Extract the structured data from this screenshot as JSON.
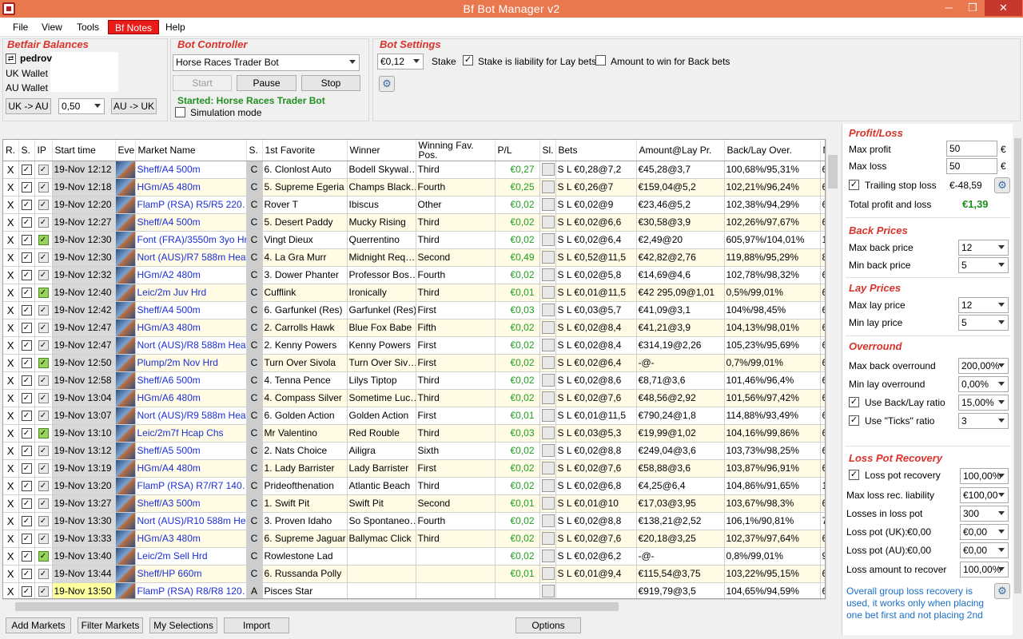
{
  "window": {
    "title": "Bf Bot Manager v2",
    "min": "─",
    "max": "❐",
    "close": "✕"
  },
  "menu": [
    "File",
    "View",
    "Tools",
    "Bf Notes",
    "Help"
  ],
  "balances": {
    "title": "Betfair Balances",
    "user": "pedrov",
    "uk_wallet": "UK Wallet",
    "au_wallet": "AU Wallet",
    "uk_to_au": "UK -> AU",
    "amount": "0,50",
    "au_to_uk": "AU -> UK"
  },
  "controller": {
    "title": "Bot Controller",
    "bot": "Horse Races Trader Bot",
    "start": "Start",
    "pause": "Pause",
    "stop": "Stop",
    "status": "Started: Horse Races Trader Bot",
    "simulation": "Simulation mode"
  },
  "settings": {
    "title": "Bot Settings",
    "stake_value": "€0,12",
    "stake": "Stake",
    "liability": "Stake is liability for Lay bets",
    "amount_win": "Amount to win for Back bets"
  },
  "grid": {
    "headers": [
      "R.",
      "S.",
      "IP",
      "Start time",
      "Eve",
      "Market Name",
      "S.",
      "1st Favorite",
      "Winner",
      "Winning Fav. Pos.",
      "P/L",
      "Sl.",
      "Bets",
      "Amount@Lay Pr.",
      "Back/Lay Over.",
      "N"
    ],
    "rows": [
      {
        "r": "X",
        "ip": "grey",
        "time": "19-Nov 12:12",
        "market": "Sheff/A4 500m",
        "type": "C",
        "fav": "6. Clonlost Auto",
        "winner": "Bodell Skywal…",
        "pos": "Third",
        "pl": "€0,27",
        "bets": "S L €0,28@7,2",
        "amount": "€45,28@3,7",
        "over": "100,68%/95,31%",
        "n": "6"
      },
      {
        "r": "X",
        "ip": "grey",
        "time": "19-Nov 12:18",
        "market": "HGm/A5 480m",
        "type": "C",
        "fav": "5. Supreme Egeria",
        "winner": "Champs Black…",
        "pos": "Fourth",
        "pl": "€0,25",
        "bets": "S L €0,26@7",
        "amount": "€159,04@5,2",
        "over": "102,21%/96,24%",
        "n": "6"
      },
      {
        "r": "X",
        "ip": "grey",
        "time": "19-Nov 12:20",
        "market": "FlamP (RSA)  R5/R5 220…",
        "type": "C",
        "fav": "Rover T",
        "winner": "Ibiscus",
        "pos": "Other",
        "pl": "€0,02",
        "bets": "S L €0,02@9",
        "amount": "€23,46@5,2",
        "over": "102,38%/94,29%",
        "n": "6"
      },
      {
        "r": "X",
        "ip": "grey",
        "time": "19-Nov 12:27",
        "market": "Sheff/A4 500m",
        "type": "C",
        "fav": "5. Desert Paddy",
        "winner": "Mucky Rising",
        "pos": "Third",
        "pl": "€0,02",
        "bets": "S L €0,02@6,6",
        "amount": "€30,58@3,9",
        "over": "102,26%/97,67%",
        "n": "6"
      },
      {
        "r": "X",
        "ip": "green",
        "time": "19-Nov 12:30",
        "market": "Font (FRA)/3550m 3yo Hrd",
        "type": "C",
        "fav": "Vingt Dieux",
        "winner": "Querrentino",
        "pos": "Third",
        "pl": "€0,02",
        "bets": "S L €0,02@6,4",
        "amount": "€2,49@20",
        "over": "605,97%/104,01%",
        "n": "1"
      },
      {
        "r": "X",
        "ip": "grey",
        "time": "19-Nov 12:30",
        "market": "Nort (AUS)/R7 588m Heat",
        "type": "C",
        "fav": "4. La Gra Murr",
        "winner": "Midnight Req…",
        "pos": "Second",
        "pl": "€0,49",
        "bets": "S L €0,52@11,5",
        "amount": "€42,82@2,76",
        "over": "119,88%/95,29%",
        "n": "8"
      },
      {
        "r": "X",
        "ip": "grey",
        "time": "19-Nov 12:32",
        "market": "HGm/A2 480m",
        "type": "C",
        "fav": "3. Dower Phanter",
        "winner": "Professor Bos…",
        "pos": "Fourth",
        "pl": "€0,02",
        "bets": "S L €0,02@5,8",
        "amount": "€14,69@4,6",
        "over": "102,78%/98,32%",
        "n": "6"
      },
      {
        "r": "X",
        "ip": "green",
        "time": "19-Nov 12:40",
        "market": "Leic/2m Juv Hrd",
        "type": "C",
        "fav": "Cufflink",
        "winner": "Ironically",
        "pos": "Third",
        "pl": "€0,01",
        "bets": "S L €0,01@11,5",
        "amount": "€42 295,09@1,01",
        "over": "0,5%/99,01%",
        "n": "6"
      },
      {
        "r": "X",
        "ip": "grey",
        "time": "19-Nov 12:42",
        "market": "Sheff/A4 500m",
        "type": "C",
        "fav": "6. Garfunkel (Res)",
        "winner": "Garfunkel (Res)",
        "pos": "First",
        "pl": "€0,03",
        "bets": "S L €0,03@5,7",
        "amount": "€41,09@3,1",
        "over": "104%/98,45%",
        "n": "6"
      },
      {
        "r": "X",
        "ip": "grey",
        "time": "19-Nov 12:47",
        "market": "HGm/A3 480m",
        "type": "C",
        "fav": "2. Carrolls Hawk",
        "winner": "Blue Fox Babe",
        "pos": "Fifth",
        "pl": "€0,02",
        "bets": "S L €0,02@8,4",
        "amount": "€41,21@3,9",
        "over": "104,13%/98,01%",
        "n": "6"
      },
      {
        "r": "X",
        "ip": "grey",
        "time": "19-Nov 12:47",
        "market": "Nort (AUS)/R8 588m Heat",
        "type": "C",
        "fav": "2. Kenny Powers",
        "winner": "Kenny Powers",
        "pos": "First",
        "pl": "€0,02",
        "bets": "S L €0,02@8,4",
        "amount": "€314,19@2,26",
        "over": "105,23%/95,69%",
        "n": "6"
      },
      {
        "r": "X",
        "ip": "green",
        "time": "19-Nov 12:50",
        "market": "Plump/2m Nov Hrd",
        "type": "C",
        "fav": "Turn Over Sivola",
        "winner": "Turn Over Siv…",
        "pos": "First",
        "pl": "€0,02",
        "bets": "S L €0,02@6,4",
        "amount": "-@-",
        "over": "0,7%/99,01%",
        "n": "6"
      },
      {
        "r": "X",
        "ip": "grey",
        "time": "19-Nov 12:58",
        "market": "Sheff/A6 500m",
        "type": "C",
        "fav": "4. Tenna Pence",
        "winner": "Lilys Tiptop",
        "pos": "Third",
        "pl": "€0,02",
        "bets": "S L €0,02@8,6",
        "amount": "€8,71@3,6",
        "over": "101,46%/96,4%",
        "n": "6"
      },
      {
        "r": "X",
        "ip": "grey",
        "time": "19-Nov 13:04",
        "market": "HGm/A6 480m",
        "type": "C",
        "fav": "4. Compass Silver",
        "winner": "Sometime Luc…",
        "pos": "Third",
        "pl": "€0,02",
        "bets": "S L €0,02@7,6",
        "amount": "€48,56@2,92",
        "over": "101,56%/97,42%",
        "n": "6"
      },
      {
        "r": "X",
        "ip": "grey",
        "time": "19-Nov 13:07",
        "market": "Nort (AUS)/R9 588m Heat",
        "type": "C",
        "fav": "6. Golden Action",
        "winner": "Golden Action",
        "pos": "First",
        "pl": "€0,01",
        "bets": "S L €0,01@11,5",
        "amount": "€790,24@1,8",
        "over": "114,88%/93,49%",
        "n": "6"
      },
      {
        "r": "X",
        "ip": "green",
        "time": "19-Nov 13:10",
        "market": "Leic/2m7f Hcap Chs",
        "type": "C",
        "fav": "Mr Valentino",
        "winner": "Red Rouble",
        "pos": "Third",
        "pl": "€0,03",
        "bets": "S L €0,03@5,3",
        "amount": "€19,99@1,02",
        "over": "104,16%/99,86%",
        "n": "6"
      },
      {
        "r": "X",
        "ip": "grey",
        "time": "19-Nov 13:12",
        "market": "Sheff/A5 500m",
        "type": "C",
        "fav": "2. Nats Choice",
        "winner": "Ailigra",
        "pos": "Sixth",
        "pl": "€0,02",
        "bets": "S L €0,02@8,8",
        "amount": "€249,04@3,6",
        "over": "103,73%/98,25%",
        "n": "6"
      },
      {
        "r": "X",
        "ip": "grey",
        "time": "19-Nov 13:19",
        "market": "HGm/A4 480m",
        "type": "C",
        "fav": "1. Lady Barrister",
        "winner": "Lady Barrister",
        "pos": "First",
        "pl": "€0,02",
        "bets": "S L €0,02@7,6",
        "amount": "€58,88@3,6",
        "over": "103,87%/96,91%",
        "n": "6"
      },
      {
        "r": "X",
        "ip": "grey",
        "time": "19-Nov 13:20",
        "market": "FlamP (RSA)  R7/R7 140…",
        "type": "C",
        "fav": "Prideofthenation",
        "winner": "Atlantic Beach",
        "pos": "Third",
        "pl": "€0,02",
        "bets": "S L €0,02@6,8",
        "amount": "€4,25@6,4",
        "over": "104,86%/91,65%",
        "n": "1"
      },
      {
        "r": "X",
        "ip": "grey",
        "time": "19-Nov 13:27",
        "market": "Sheff/A3 500m",
        "type": "C",
        "fav": "1. Swift Pit",
        "winner": "Swift Pit",
        "pos": "Second",
        "pl": "€0,01",
        "bets": "S L €0,01@10",
        "amount": "€17,03@3,95",
        "over": "103,67%/98,3%",
        "n": "6"
      },
      {
        "r": "X",
        "ip": "grey",
        "time": "19-Nov 13:30",
        "market": "Nort (AUS)/R10 588m Heat",
        "type": "C",
        "fav": "3. Proven Idaho",
        "winner": "So Spontaneo…",
        "pos": "Fourth",
        "pl": "€0,02",
        "bets": "S L €0,02@8,8",
        "amount": "€138,21@2,52",
        "over": "106,1%/90,81%",
        "n": "7"
      },
      {
        "r": "X",
        "ip": "grey",
        "time": "19-Nov 13:33",
        "market": "HGm/A3 480m",
        "type": "C",
        "fav": "6. Supreme Jaguar",
        "winner": "Ballymac Click",
        "pos": "Third",
        "pl": "€0,02",
        "bets": "S L €0,02@7,6",
        "amount": "€20,18@3,25",
        "over": "102,37%/97,64%",
        "n": "6"
      },
      {
        "r": "X",
        "ip": "green",
        "time": "19-Nov 13:40",
        "market": "Leic/2m Sell Hrd",
        "type": "C",
        "fav": "Rowlestone Lad",
        "winner": "",
        "pos": "",
        "pl": "€0,02",
        "bets": "S L €0,02@6,2",
        "amount": "-@-",
        "over": "0,8%/99,01%",
        "n": "9"
      },
      {
        "r": "X",
        "ip": "grey",
        "time": "19-Nov 13:44",
        "market": "Sheff/HP 660m",
        "type": "C",
        "fav": "6. Russanda Polly",
        "winner": "",
        "pos": "",
        "pl": "€0,01",
        "bets": "S L €0,01@9,4",
        "amount": "€115,54@3,75",
        "over": "103,22%/95,15%",
        "n": "6"
      },
      {
        "r": "X",
        "ip": "grey",
        "time": "19-Nov 13:50",
        "market": "FlamP (RSA)  R8/R8 120…",
        "type": "A",
        "fav": "Pisces Star",
        "winner": "",
        "pos": "",
        "pl": "",
        "bets": "",
        "amount": "€919,79@3,5",
        "over": "104,65%/94,59%",
        "n": "6"
      }
    ]
  },
  "bottom": {
    "add_markets": "Add Markets",
    "filter_markets": "Filter Markets",
    "my_selections": "My Selections",
    "import": "Import",
    "options": "Options"
  },
  "right": {
    "pl_title": "Profit/Loss",
    "max_profit": "Max profit",
    "max_profit_val": "50",
    "max_loss": "Max loss",
    "max_loss_val": "50",
    "currency": "€",
    "trailing": "Trailing stop loss",
    "trailing_val": "€-48,59",
    "total": "Total profit and loss",
    "total_val": "€1,39",
    "back_title": "Back Prices",
    "max_back": "Max back price",
    "max_back_val": "12",
    "min_back": "Min back price",
    "min_back_val": "5",
    "lay_title": "Lay Prices",
    "max_lay": "Max lay price",
    "max_lay_val": "12",
    "min_lay": "Min lay price",
    "min_lay_val": "5",
    "over_title": "Overround",
    "max_back_over": "Max back overround",
    "max_back_over_val": "200,00%",
    "min_lay_over": "Min lay overround",
    "min_lay_over_val": "0,00%",
    "use_ratio": "Use Back/Lay ratio",
    "use_ratio_val": "15,00%",
    "use_ticks": "Use \"Ticks\" ratio",
    "use_ticks_val": "3",
    "lpr_title": "Loss Pot Recovery",
    "lpr": "Loss pot recovery",
    "lpr_val": "100,00%",
    "max_liab": "Max loss rec. liability",
    "max_liab_val": "€100,00",
    "losses": "Losses in loss pot",
    "losses_val": "300",
    "pot_uk": "Loss pot (UK):",
    "pot_uk_amt": "€0,00",
    "pot_uk_val": "€0,00",
    "pot_au": "Loss pot (AU):",
    "pot_au_amt": "€0,00",
    "pot_au_val": "€0,00",
    "recover": "Loss amount to recover",
    "recover_val": "100,00%",
    "note": "Overall group loss recovery is used, it works only when placing one bet first and not placing 2nd"
  },
  "colors": {
    "title_bar": "#e9784f",
    "accent_red": "#d9322a",
    "link_blue": "#1a2fd6",
    "pl_green": "#1f9e1f",
    "alt_row": "#fffbe5"
  }
}
